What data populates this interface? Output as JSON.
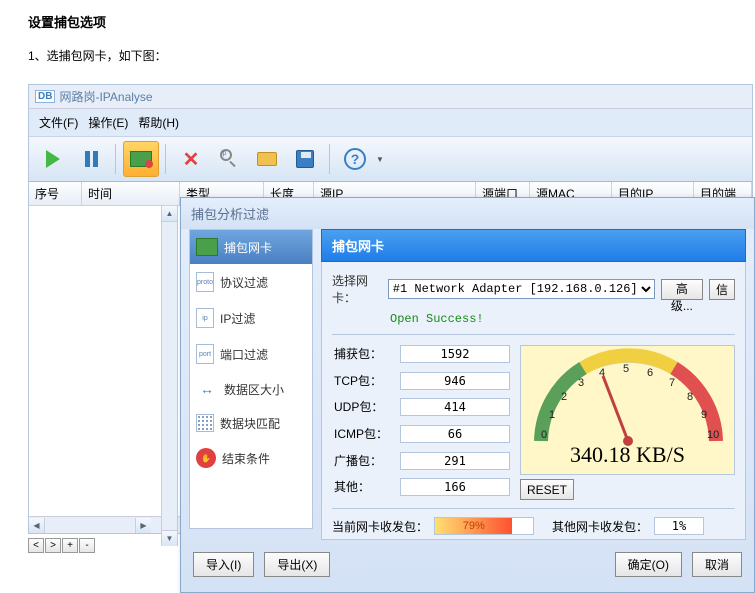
{
  "doc": {
    "title": "设置捕包选项",
    "step1": "1、选捕包网卡，如下图："
  },
  "app": {
    "title_prefix": "DB",
    "title": "网路岗-IPAnalyse",
    "menu": {
      "file": "文件(F)",
      "action": "操作(E)",
      "help": "帮助(H)"
    },
    "columns": {
      "seq": "序号",
      "time": "时间",
      "type": "类型",
      "length": "长度",
      "srcip": "源IP",
      "srcport": "源端口",
      "srcmac": "源MAC",
      "dstip": "目的IP",
      "dstport": "目的端"
    }
  },
  "dialog": {
    "title": "捕包分析过滤",
    "sidebar": {
      "nic": "捕包网卡",
      "protocol": "协议过滤",
      "ip": "IP过滤",
      "port": "端口过滤",
      "datasize": "数据区大小",
      "datablock": "数据块匹配",
      "end": "结束条件"
    },
    "panel": {
      "header": "捕包网卡",
      "select_label": "选择网卡：",
      "adapter": "#1 Network Adapter [192.168.0.126]",
      "advanced_btn": "高级...",
      "info_btn": "信",
      "status": "Open Success!",
      "stats": {
        "captured_lbl": "捕获包：",
        "captured": "1592",
        "tcp_lbl": "TCP包：",
        "tcp": "946",
        "udp_lbl": "UDP包：",
        "udp": "414",
        "icmp_lbl": "ICMP包：",
        "icmp": "66",
        "broadcast_lbl": "广播包：",
        "broadcast": "291",
        "other_lbl": "其他：",
        "other": "166"
      },
      "gauge_speed": "340.18 KB/S",
      "reset": "RESET",
      "traffic": {
        "current_lbl": "当前网卡收发包：",
        "current_pct": "79%",
        "other_lbl": "其他网卡收发包：",
        "other_pct": "1%"
      }
    },
    "footer": {
      "import": "导入(I)",
      "export": "导出(X)",
      "ok": "确定(O)",
      "cancel": "取消"
    }
  },
  "side_icons": {
    "proto": "proto",
    "ip": "ip",
    "port": "port"
  }
}
